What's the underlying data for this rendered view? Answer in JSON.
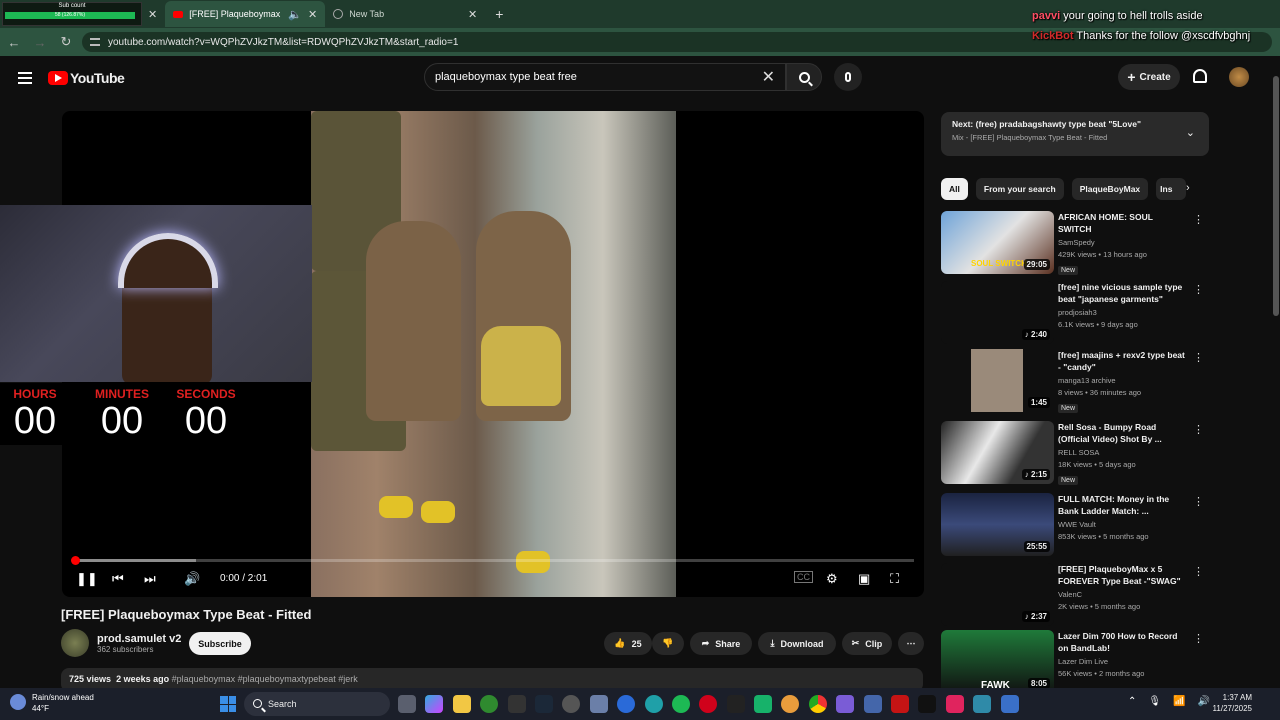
{
  "browser": {
    "stream_goal": {
      "label": "Sub count",
      "bar_text": "58 (126.87%)"
    },
    "tabs": [
      {
        "title": "[FREE] Plaqueboymax Type",
        "active": true
      },
      {
        "title": "New Tab",
        "active": false
      }
    ],
    "url": "youtube.com/watch?v=WQPhZVJkzTM&list=RDWQPhZVJkzTM&start_radio=1"
  },
  "chat_overlay": [
    {
      "user": "pavvi",
      "message": "your going to hell trolls aside"
    },
    {
      "user": "KickBot",
      "message": "Thanks for the follow @xscdfvbghnj"
    }
  ],
  "youtube": {
    "logo_text": "YouTube",
    "search_value": "plaqueboymax type beat free",
    "create_label": "Create"
  },
  "player": {
    "time": "0:00 / 2:01",
    "progress_fraction": 0.0,
    "buffered_fraction": 0.145
  },
  "timer_overlay": {
    "hours_label": "HOURS",
    "hours": "00",
    "minutes_label": "MINUTES",
    "minutes": "00",
    "seconds_label": "SECONDS",
    "seconds": "00"
  },
  "video": {
    "title": "[FREE] Plaqueboymax Type Beat - Fitted",
    "channel": "prod.samulet v2",
    "subscribers": "362 subscribers",
    "subscribe_label": "Subscribe",
    "likes": "25",
    "share_label": "Share",
    "download_label": "Download",
    "clip_label": "Clip",
    "views": "725 views",
    "age": "2 weeks ago",
    "tags": "#plaqueboymax #plaqueboymaxtypebeat #jerk"
  },
  "up_next": {
    "title": "Next: (free) pradabagshawty type beat \"5Love\"",
    "subtitle": "Mix - [FREE] Plaqueboymax Type Beat - Fitted"
  },
  "chips": [
    "All",
    "From your search",
    "PlaqueBoyMax",
    "Ins"
  ],
  "recommendations": [
    {
      "title": "AFRICAN HOME: SOUL SWITCH",
      "channel": "SamSpedy",
      "meta": "429K views • 13 hours ago",
      "badge": "New",
      "duration": "29:05",
      "thumb_text": "SOUL SWITCH"
    },
    {
      "title": "[free] nine vicious sample type beat \"japanese garments\"",
      "channel": "prodjosiah3",
      "meta": "6.1K views • 9 days ago",
      "badge": "",
      "duration": "♪ 2:40",
      "thumb_text": ""
    },
    {
      "title": "[free] maajins + rexv2 type beat - \"candy\"",
      "channel": "manga13 archive",
      "meta": "8 views • 36 minutes ago",
      "badge": "New",
      "duration": "1:45",
      "thumb_text": ""
    },
    {
      "title": "Rell Sosa - Bumpy Road (Official Video) Shot By ...",
      "channel": "RELL SOSA",
      "meta": "18K views • 5 days ago",
      "badge": "New",
      "duration": "♪ 2:15",
      "thumb_text": ""
    },
    {
      "title": "FULL MATCH: Money in the Bank Ladder Match: ...",
      "channel": "WWE Vault",
      "meta": "853K views • 5 months ago",
      "badge": "",
      "duration": "25:55",
      "thumb_text": ""
    },
    {
      "title": "[FREE] PlaqueboyMax x 5 FOREVER Type Beat -\"SWAG\"",
      "channel": "ValenC",
      "meta": "2K views • 5 months ago",
      "badge": "",
      "duration": "♪ 2:37",
      "thumb_text": ""
    },
    {
      "title": "Lazer Dim 700 How to Record on BandLab!",
      "channel": "Lazer Dim Live",
      "meta": "56K views • 2 months ago",
      "badge": "",
      "duration": "8:05",
      "thumb_text": "FAWK"
    }
  ],
  "taskbar": {
    "weather_title": "Rain/snow ahead",
    "weather_temp": "44°F",
    "search_label": "Search",
    "time": "1:37 AM",
    "date": "11/27/2025"
  },
  "colors": {
    "brand_red": "#ff0000",
    "browser_green": "#2d5440",
    "page_bg": "#0f0f0f"
  }
}
